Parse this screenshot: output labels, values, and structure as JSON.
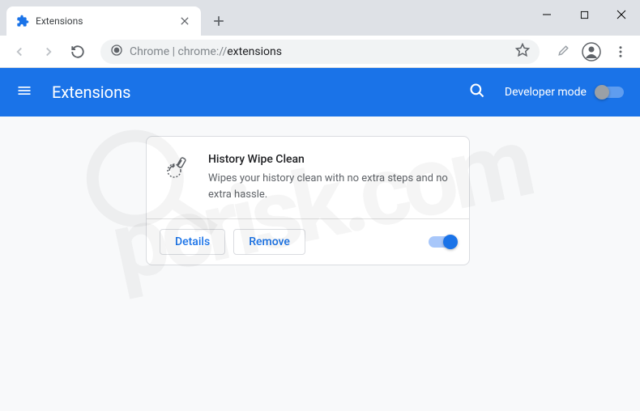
{
  "window": {
    "tab_title": "Extensions"
  },
  "omnibox": {
    "prefix": "Chrome",
    "separator": " | ",
    "scheme": "chrome://",
    "path": "extensions"
  },
  "header": {
    "title": "Extensions",
    "dev_mode_label": "Developer mode"
  },
  "extension": {
    "name": "History Wipe Clean",
    "description": "Wipes your history clean with no extra steps and no extra hassle.",
    "details_label": "Details",
    "remove_label": "Remove"
  },
  "watermark": {
    "text": "pcrisk.com"
  }
}
